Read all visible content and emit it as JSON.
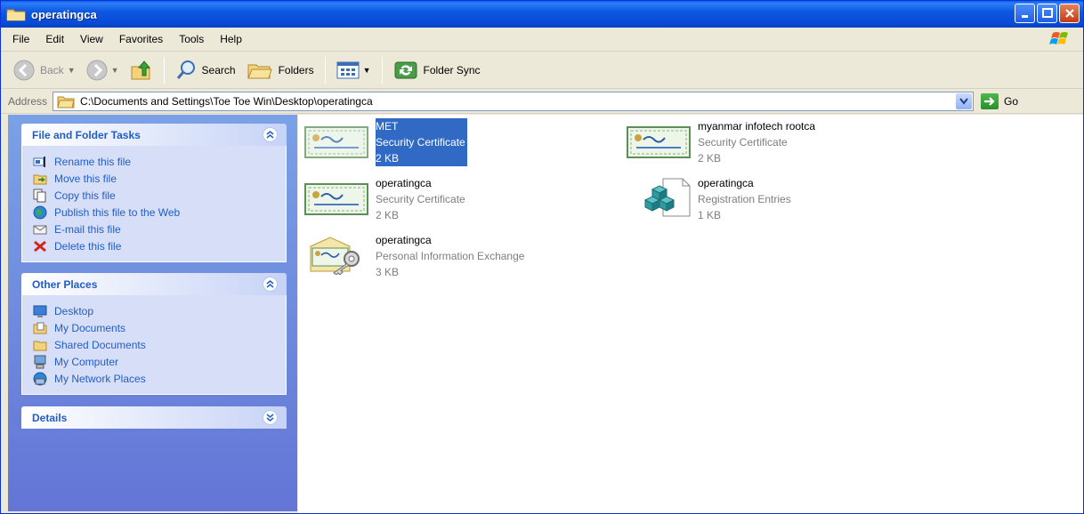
{
  "window": {
    "title": "operatingca"
  },
  "menu": [
    "File",
    "Edit",
    "View",
    "Favorites",
    "Tools",
    "Help"
  ],
  "toolbar": {
    "back": "Back",
    "search": "Search",
    "folders": "Folders",
    "folder_sync": "Folder Sync"
  },
  "address": {
    "label": "Address",
    "path": "C:\\Documents and Settings\\Toe Toe Win\\Desktop\\operatingca",
    "go": "Go"
  },
  "sidebar": {
    "file_tasks": {
      "title": "File and Folder Tasks",
      "items": [
        {
          "label": "Rename this file",
          "icon": "rename-icon"
        },
        {
          "label": "Move this file",
          "icon": "move-icon"
        },
        {
          "label": "Copy this file",
          "icon": "copy-icon"
        },
        {
          "label": "Publish this file to the Web",
          "icon": "web-publish-icon"
        },
        {
          "label": "E-mail this file",
          "icon": "email-icon"
        },
        {
          "label": "Delete this file",
          "icon": "delete-icon"
        }
      ]
    },
    "other_places": {
      "title": "Other Places",
      "items": [
        {
          "label": "Desktop",
          "icon": "desktop-icon"
        },
        {
          "label": "My Documents",
          "icon": "my-documents-icon"
        },
        {
          "label": "Shared Documents",
          "icon": "shared-folder-icon"
        },
        {
          "label": "My Computer",
          "icon": "my-computer-icon"
        },
        {
          "label": "My Network Places",
          "icon": "network-places-icon"
        }
      ]
    },
    "details": {
      "title": "Details"
    }
  },
  "files": [
    {
      "name": "MET",
      "type": "Security Certificate",
      "size": "2 KB",
      "icon": "certificate-icon",
      "selected": true
    },
    {
      "name": "myanmar infotech rootca",
      "type": "Security Certificate",
      "size": "2 KB",
      "icon": "certificate-icon",
      "selected": false
    },
    {
      "name": "operatingca",
      "type": "Security Certificate",
      "size": "2 KB",
      "icon": "certificate-icon",
      "selected": false
    },
    {
      "name": "operatingca",
      "type": "Registration Entries",
      "size": "1 KB",
      "icon": "registry-icon",
      "selected": false
    },
    {
      "name": "operatingca",
      "type": "Personal Information Exchange",
      "size": "3 KB",
      "icon": "pfx-key-icon",
      "selected": false
    }
  ],
  "colors": {
    "titlebar": "#0a5ee9",
    "selection": "#316ac5",
    "taskpane": "#6375d6",
    "link": "#215dc6"
  }
}
